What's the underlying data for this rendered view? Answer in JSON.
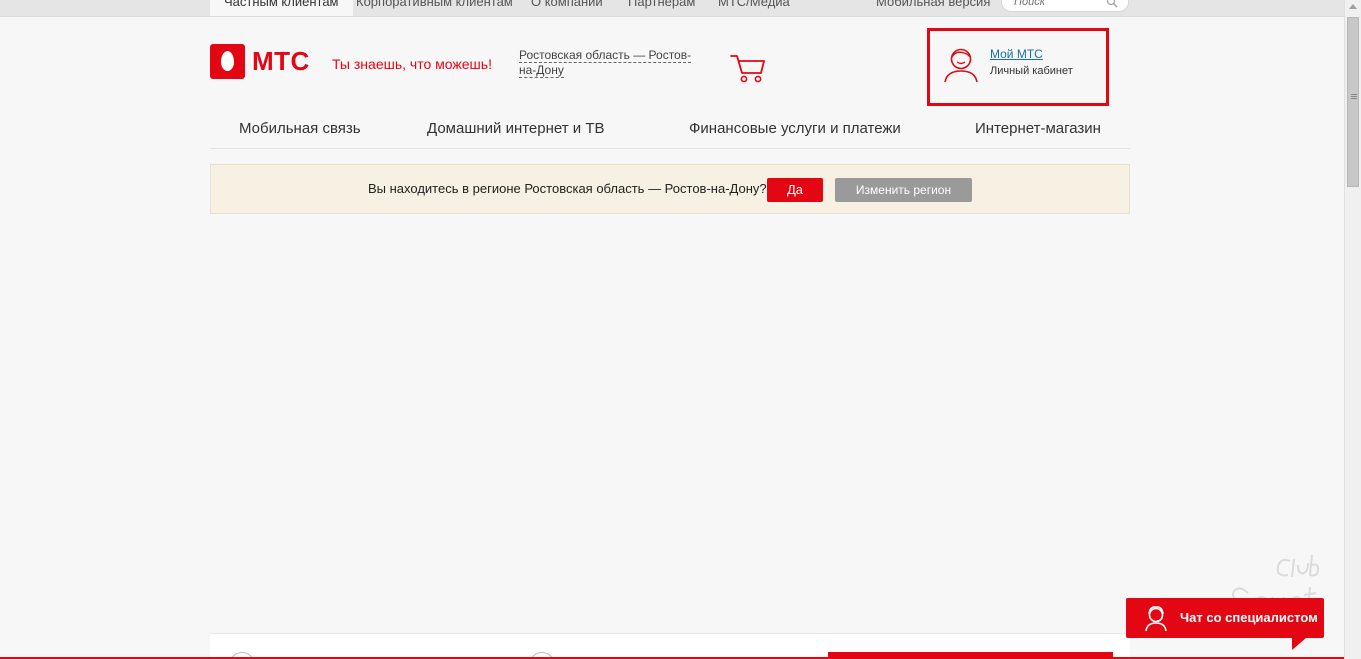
{
  "top_tabs": [
    {
      "label": "Частным клиентам",
      "active": true
    },
    {
      "label": "Корпоративным клиентам",
      "active": false
    },
    {
      "label": "О компании",
      "active": false
    },
    {
      "label": "Партнерам",
      "active": false
    },
    {
      "label": "МТС/Медиа",
      "active": false
    }
  ],
  "mobile_version_label": "Мобильная версия",
  "search": {
    "placeholder": "Поиск",
    "icon": "search-icon"
  },
  "logo": {
    "text": "МТС",
    "brand_color": "#e30613"
  },
  "slogan": "Ты знаешь, что можешь!",
  "region_link": "Ростовская область — Ростов-на-Дону",
  "cart_icon": "cart-icon",
  "account": {
    "title": "Мой МТС",
    "subtitle": "Личный кабинет",
    "icon": "user-avatar-icon",
    "highlight_color": "#e30613"
  },
  "main_nav": [
    {
      "label": "Мобильная связь"
    },
    {
      "label": "Домашний интернет и ТВ"
    },
    {
      "label": "Финансовые услуги и платежи"
    },
    {
      "label": "Интернет-магазин"
    }
  ],
  "region_banner": {
    "question": "Вы находитесь в регионе Ростовская область — Ростов-на-Дону?",
    "yes_label": "Да",
    "change_label": "Изменить регион"
  },
  "chat": {
    "label": "Чат со специалистом",
    "icon": "chat-operator-icon"
  },
  "watermark": {
    "text_line1": "club",
    "text_line2": "Sovet"
  }
}
